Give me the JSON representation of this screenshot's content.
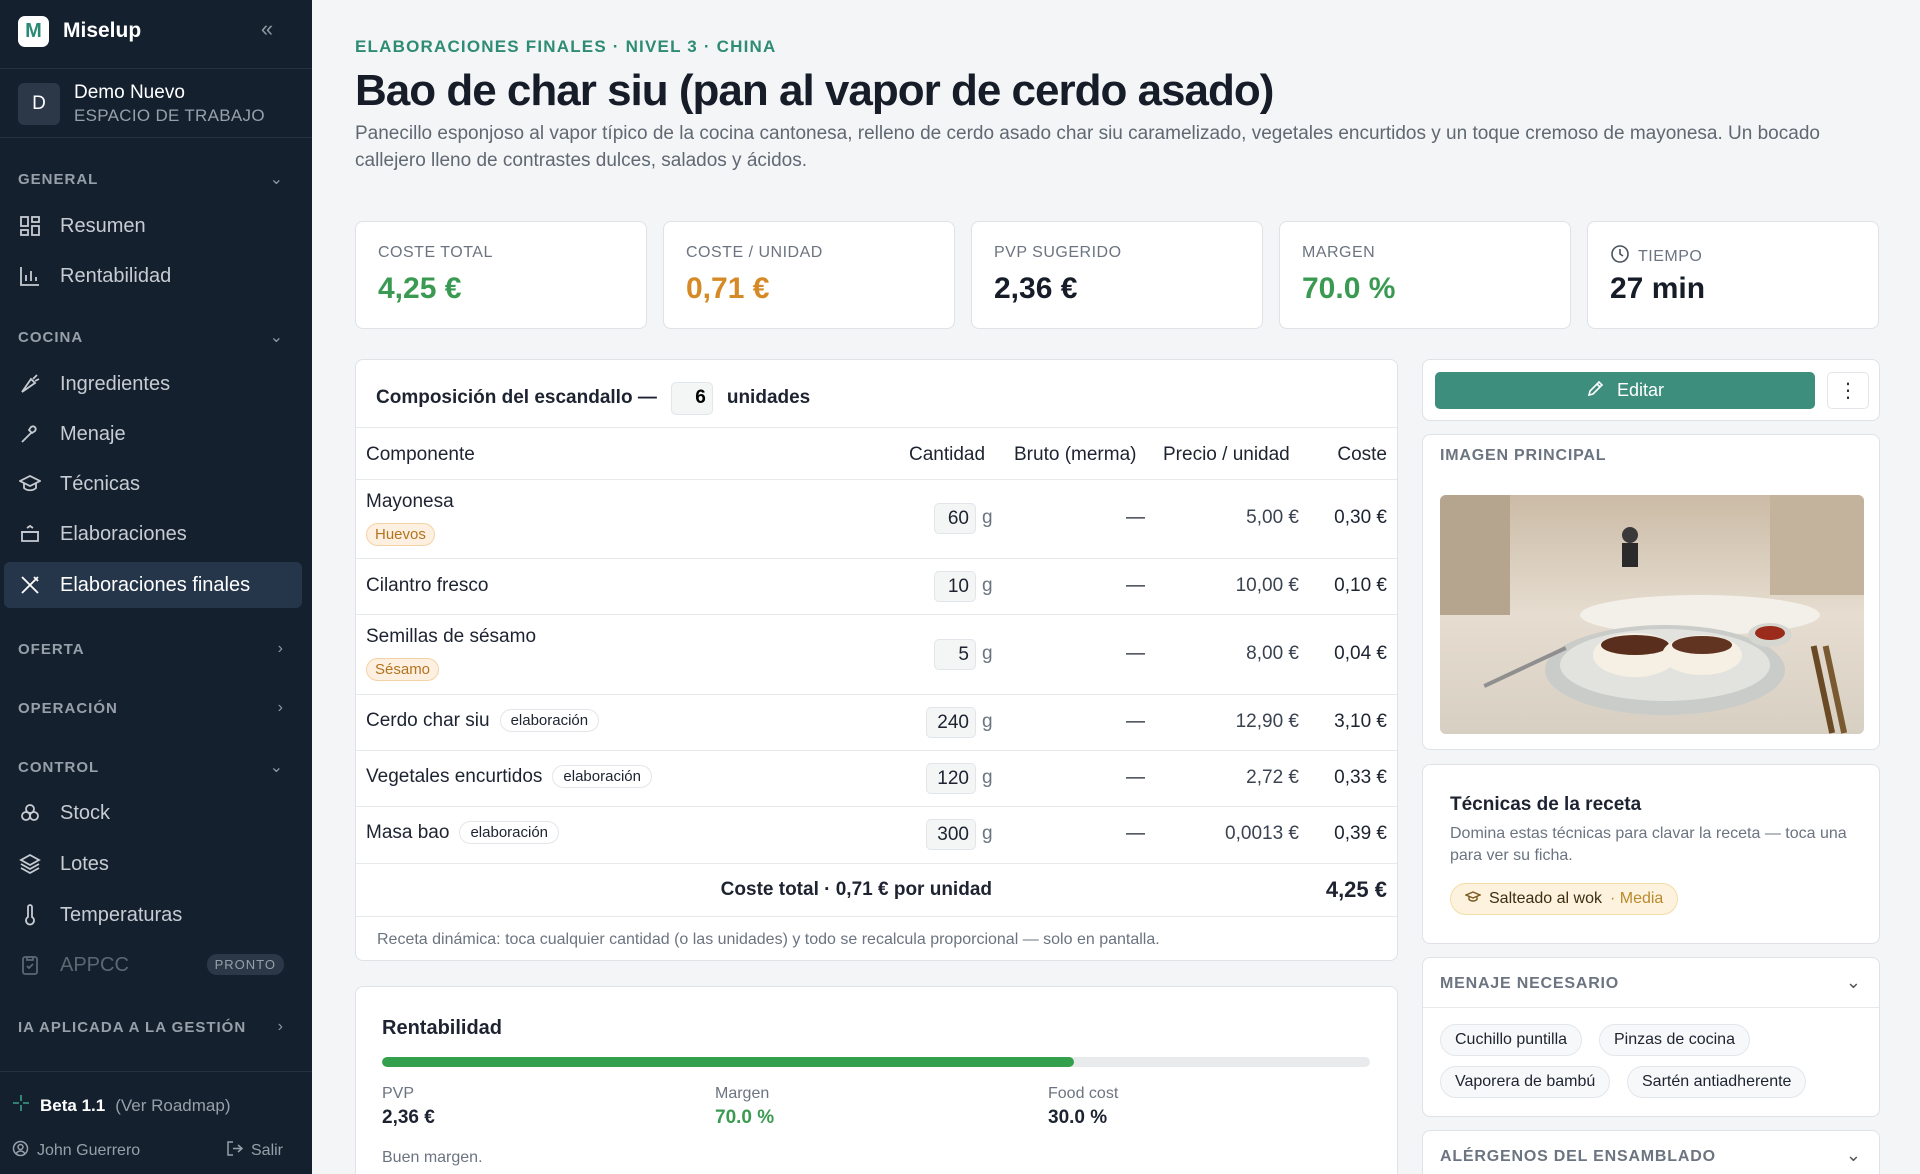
{
  "app": {
    "logo_letter": "M",
    "name": "Miselup"
  },
  "workspace": {
    "initial": "D",
    "name": "Demo Nuevo",
    "sub": "ESPACIO DE TRABAJO"
  },
  "nav": {
    "general": {
      "label": "GENERAL",
      "items": [
        "Resumen",
        "Rentabilidad"
      ]
    },
    "cocina": {
      "label": "COCINA",
      "items": [
        "Ingredientes",
        "Menaje",
        "Técnicas",
        "Elaboraciones",
        "Elaboraciones finales"
      ]
    },
    "oferta": {
      "label": "OFERTA"
    },
    "operacion": {
      "label": "OPERACIÓN"
    },
    "control": {
      "label": "CONTROL",
      "items": [
        "Stock",
        "Lotes",
        "Temperaturas",
        "APPCC"
      ],
      "badge": "PRONTO"
    },
    "ia": {
      "label": "IA APLICADA A LA GESTIÓN"
    }
  },
  "footer": {
    "beta": "Beta 1.1",
    "roadmap": "(Ver Roadmap)",
    "user": "John Guerrero",
    "logout": "Salir"
  },
  "page": {
    "breadcrumb": "ELABORACIONES FINALES  · NIVEL 3 · CHINA",
    "title": "Bao de char siu (pan al vapor de cerdo asado)",
    "description": "Panecillo esponjoso al vapor típico de la cocina cantonesa, relleno de cerdo asado char siu caramelizado, vegetales encurtidos y un toque cremoso de mayonesa. Un bocado callejero lleno de contrastes dulces, salados y ácidos."
  },
  "kpis": [
    {
      "label": "COSTE TOTAL",
      "value": "4,25 €",
      "color": "#3a9a52"
    },
    {
      "label": "COSTE / UNIDAD",
      "value": "0,71 €",
      "color": "#d58a26"
    },
    {
      "label": "PVP SUGERIDO",
      "value": "2,36 €",
      "color": "#161c28"
    },
    {
      "label": "MARGEN",
      "value": "70.0 %",
      "color": "#3a9a52"
    },
    {
      "label": "TIEMPO",
      "value": "27 min",
      "color": "#161c28"
    }
  ],
  "composition": {
    "label": "Composición del escandallo —",
    "units_value": "6",
    "units_label": "unidades",
    "columns": [
      "Componente",
      "Cantidad",
      "Bruto (merma)",
      "Precio / unidad",
      "Coste"
    ],
    "rows": [
      {
        "name": "Mayonesa",
        "allergen": "Huevos",
        "qty": "60",
        "unit": "g",
        "bruto": "—",
        "price": "5,00 €",
        "cost": "0,30 €"
      },
      {
        "name": "Cilantro fresco",
        "qty": "10",
        "unit": "g",
        "bruto": "—",
        "price": "10,00 €",
        "cost": "0,10 €"
      },
      {
        "name": "Semillas de sésamo",
        "allergen": "Sésamo",
        "qty": "5",
        "unit": "g",
        "bruto": "—",
        "price": "8,00 €",
        "cost": "0,04 €"
      },
      {
        "name": "Cerdo char siu",
        "tag": "elaboración",
        "qty": "240",
        "unit": "g",
        "bruto": "—",
        "price": "12,90 €",
        "cost": "3,10 €"
      },
      {
        "name": "Vegetales encurtidos",
        "tag": "elaboración",
        "qty": "120",
        "unit": "g",
        "bruto": "—",
        "price": "2,72 €",
        "cost": "0,33 €"
      },
      {
        "name": "Masa bao",
        "tag": "elaboración",
        "qty": "300",
        "unit": "g",
        "bruto": "—",
        "price": "0,0013 €",
        "cost": "0,39 €"
      }
    ],
    "total_label": "Coste total · 0,71 € por unidad",
    "total_value": "4,25 €",
    "hint": "Receta dinámica: toca cualquier cantidad (o las unidades) y todo se recalcula proporcional — solo en pantalla."
  },
  "rentabilidad": {
    "title": "Rentabilidad",
    "margin_fraction": 0.7,
    "pvp_label": "PVP",
    "pvp": "2,36 €",
    "margin_label": "Margen",
    "margin": "70.0 %",
    "food_label": "Food cost",
    "food": "30.0 %",
    "note": "Buen margen."
  },
  "actions": {
    "edit": "Editar"
  },
  "image": {
    "label": "IMAGEN PRINCIPAL"
  },
  "tecnicas": {
    "title": "Técnicas de la receta",
    "desc": "Domina estas técnicas para clavar la receta — toca una para ver su ficha.",
    "chip_name": "Salteado al wok",
    "chip_level": "· Media"
  },
  "menaje": {
    "label": "MENAJE NECESARIO",
    "items": [
      "Cuchillo puntilla",
      "Pinzas de cocina",
      "Vaporera de bambú",
      "Sartén antiadherente"
    ]
  },
  "alergenos": {
    "label": "ALÉRGENOS DEL ENSAMBLADO"
  }
}
